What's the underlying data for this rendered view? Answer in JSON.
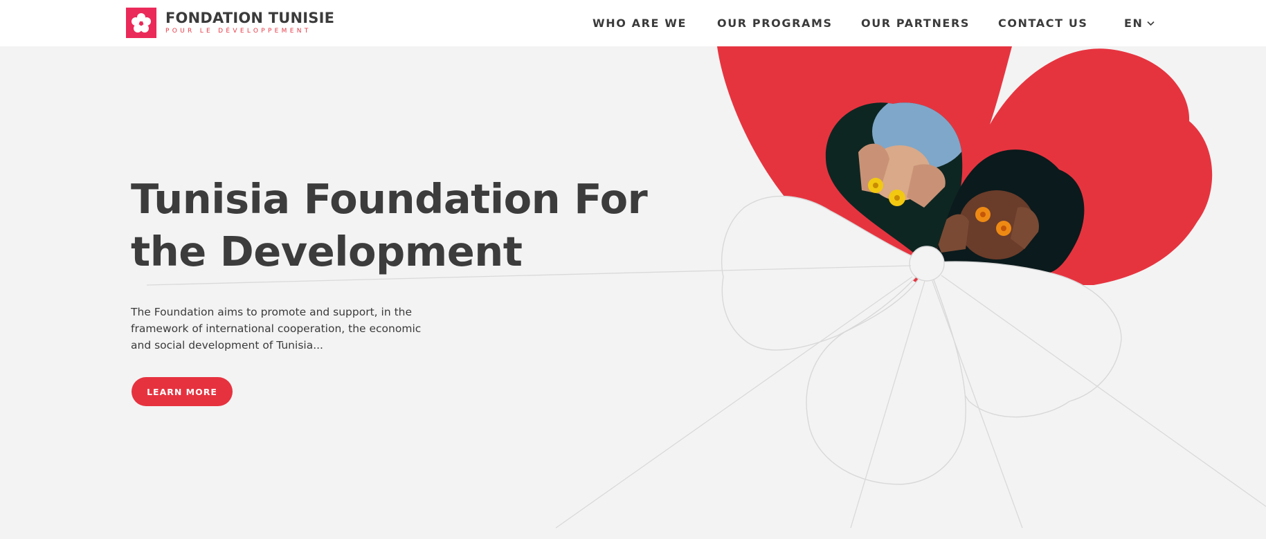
{
  "brand": {
    "name": "FONDATION TUNISIE",
    "tagline": "POUR LE DÉVELOPPEMENT",
    "logo_icon": "flower-icon",
    "color": "#ea2a59"
  },
  "nav": {
    "items": [
      {
        "label": "WHO ARE WE"
      },
      {
        "label": "OUR PROGRAMS"
      },
      {
        "label": "OUR PARTNERS"
      },
      {
        "label": "CONTACT US"
      }
    ],
    "language": "EN",
    "language_icon": "chevron-down-icon"
  },
  "hero": {
    "title": "Tunisia Foundation For the Development",
    "description": "The Foundation aims to promote and support, in the framework of international cooperation, the economic and social development of Tunisia...",
    "cta_label": "LEARN MORE"
  },
  "colors": {
    "accent": "#e6323f",
    "background": "#f3f3f3",
    "text": "#3a3a3a"
  }
}
